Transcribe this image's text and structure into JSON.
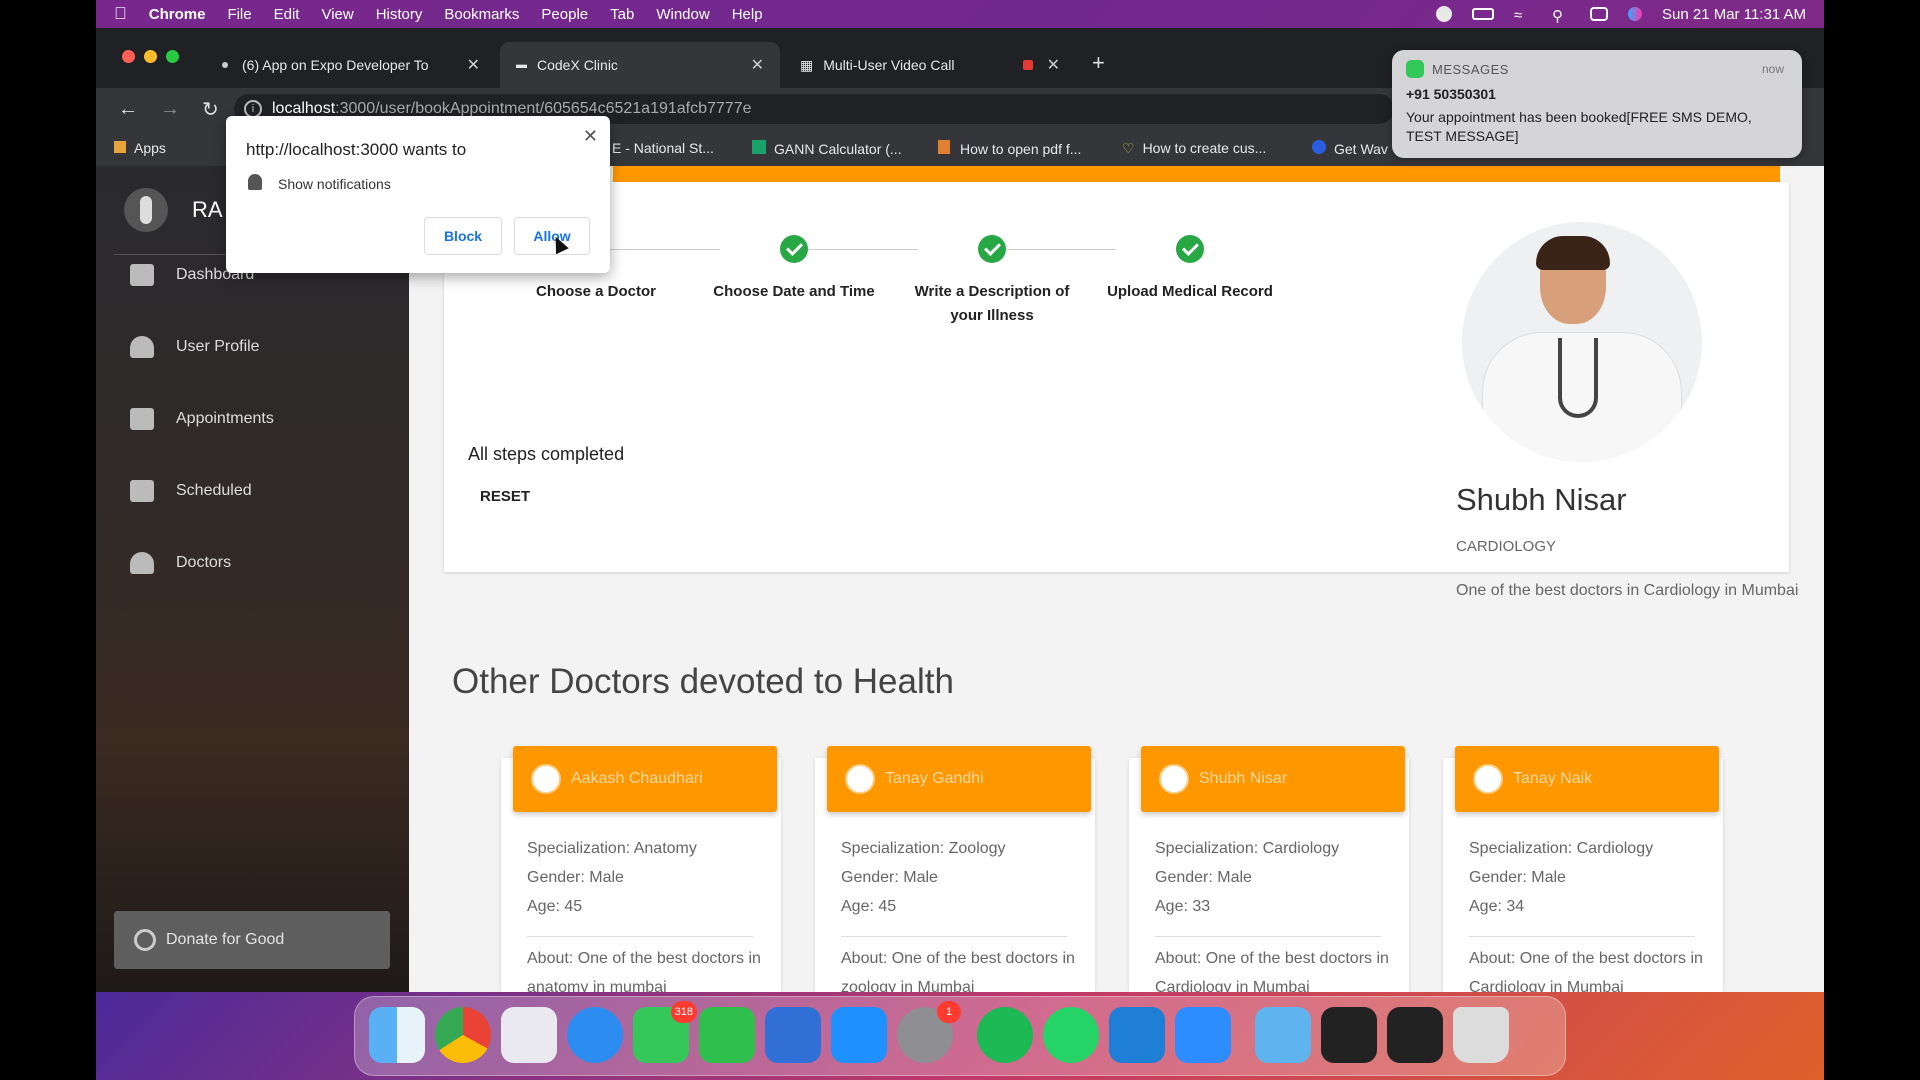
{
  "menubar": {
    "app": "Chrome",
    "items": [
      "File",
      "Edit",
      "View",
      "History",
      "Bookmarks",
      "People",
      "Tab",
      "Window",
      "Help"
    ],
    "datetime": "Sun 21 Mar  11:31 AM"
  },
  "tabs": [
    {
      "label": "(6) App on Expo Developer To"
    },
    {
      "label": "CodeX Clinic"
    },
    {
      "label": "Multi-User Video Call"
    }
  ],
  "address": {
    "host": "localhost",
    "path": ":3000/user/bookAppointment/605654c6521a191afcb7777e"
  },
  "bookmarks": [
    "Apps",
    "E - National St...",
    "GANN Calculator (...",
    "How to open pdf f...",
    "How to create cus...",
    "Get Wav"
  ],
  "permission": {
    "title": "http://localhost:3000 wants to",
    "item": "Show notifications",
    "block_label": "Block",
    "allow_label": "Allow"
  },
  "notification": {
    "app": "MESSAGES",
    "time": "now",
    "from": "+91 50350301",
    "body": "Your appointment has been booked[FREE SMS DEMO, TEST MESSAGE]"
  },
  "sidebar": {
    "user_initials": "RA",
    "items": [
      {
        "label": "Dashboard",
        "icon": "dashboard-icon"
      },
      {
        "label": "User Profile",
        "icon": "person-icon"
      },
      {
        "label": "Appointments",
        "icon": "clipboard-icon"
      },
      {
        "label": "Scheduled",
        "icon": "video-icon"
      },
      {
        "label": "Doctors",
        "icon": "doctor-search-icon"
      }
    ],
    "donate_label": "Donate for Good"
  },
  "stepper": {
    "steps": [
      "Choose a Doctor",
      "Choose Date and Time",
      "Write a Description of your Illness",
      "Upload Medical Record"
    ],
    "completed_text": "All steps completed",
    "reset_label": "RESET"
  },
  "doctor": {
    "name": "Shubh Nisar",
    "specialization": "CARDIOLOGY",
    "about": "One of the best doctors in Cardiology in Mumbai"
  },
  "others": {
    "heading": "Other Doctors devoted to Health",
    "cards": [
      {
        "name": "Aakash Chaudhari",
        "spec": "Specialization: Anatomy",
        "gender": "Gender: Male",
        "age": "Age: 45",
        "about": "About: One of the best doctors in anatomy in mumbai"
      },
      {
        "name": "Tanay Gandhi",
        "spec": "Specialization: Zoology",
        "gender": "Gender: Male",
        "age": "Age: 45",
        "about": "About: One of the best doctors in zoology in Mumbai"
      },
      {
        "name": "Shubh Nisar",
        "spec": "Specialization: Cardiology",
        "gender": "Gender: Male",
        "age": "Age: 33",
        "about": "About: One of the best doctors in Cardiology in Mumbai"
      },
      {
        "name": "Tanay Naik",
        "spec": "Specialization: Cardiology",
        "gender": "Gender: Male",
        "age": "Age: 34",
        "about": "About: One of the best doctors in Cardiology in Mumbai"
      }
    ]
  },
  "dock": {
    "messages_badge": "318",
    "settings_badge": "1"
  },
  "colors": {
    "accent": "#ff9800",
    "success": "#28a745"
  }
}
